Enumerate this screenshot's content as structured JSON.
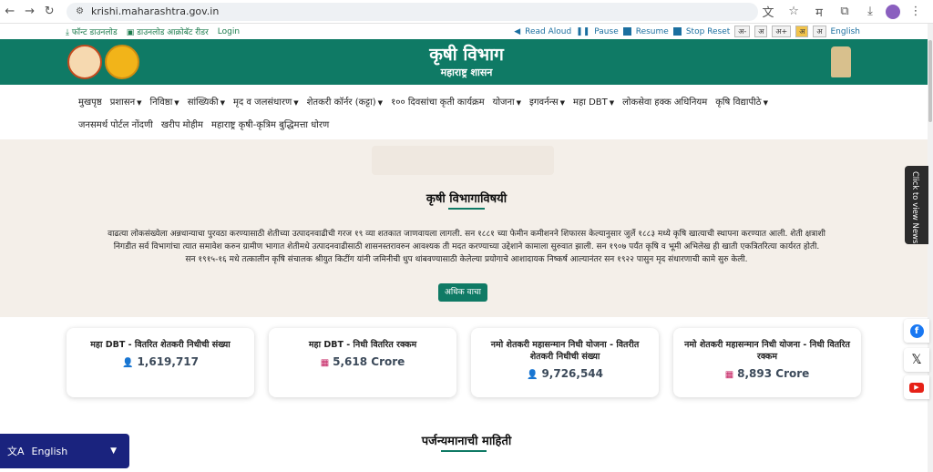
{
  "browser": {
    "url": "krishi.maharashtra.gov.in",
    "profile_initial": "म"
  },
  "toolbar": {
    "font_download": "फॉन्ट डाउनलोड",
    "acrobat_download": "डाउनलोड आक्रोबॅट रीडर",
    "login": "Login",
    "read_aloud": "Read Aloud",
    "pause": "Pause",
    "resume": "Resume",
    "stop_reset": "Stop Reset",
    "font_small": "अ-",
    "font_normal": "अ",
    "font_large": "अ+",
    "contrast1": "अ",
    "contrast2": "अ",
    "english": "English"
  },
  "header": {
    "title": "कृषी विभाग",
    "subtitle": "महाराष्ट्र शासन"
  },
  "nav": {
    "row1": [
      {
        "label": "मुखपृष्ठ",
        "dropdown": false
      },
      {
        "label": "प्रशासन",
        "dropdown": true
      },
      {
        "label": "निविष्ठा",
        "dropdown": true
      },
      {
        "label": "सांख्यिकी",
        "dropdown": true
      },
      {
        "label": "मृद व जलसंधारण",
        "dropdown": true
      },
      {
        "label": "शेतकरी कॉर्नर (कट्टा)",
        "dropdown": true
      },
      {
        "label": "१०० दिवसांचा कृती कार्यक्रम",
        "dropdown": false
      },
      {
        "label": "योजना",
        "dropdown": true
      },
      {
        "label": "इगवर्नन्स",
        "dropdown": true
      },
      {
        "label": "महा DBT",
        "dropdown": true
      },
      {
        "label": "लोकसेवा हक्क अधिनियम",
        "dropdown": false
      },
      {
        "label": "कृषि विद्यापीठे",
        "dropdown": true
      }
    ],
    "row2": [
      {
        "label": "जनसमर्थ पोर्टल नोंदणी"
      },
      {
        "label": "खरीप मोहीम"
      },
      {
        "label": "महाराष्ट्र कृषी-कृत्रिम बुद्धिमत्ता धोरण"
      }
    ]
  },
  "about": {
    "title": "कृषी विभागाविषयी",
    "text": "वाढत्या लोकसंख्येला अन्नधान्याचा पुरवठा करण्यासाठी शेतीच्या उत्पादनवाढीची गरज १९ व्या शतकात जाणवायला लागली. सन १८८१ च्या फेमीन कमीशनने शिफारस केल्यानुसार जुर्ले १८८३ मध्ये कृषि खात्याची स्थापना करण्यात आली. शेती क्षत्राशी निगडीत सर्व विभागांचा त्यात समावेश करुन ग्रामीण भागात शेतीमधे उत्पादनवाढीसाठी शासनस्तरावरुन आवश्यक ती मदत करण्याच्या उद्देशाने कामाला सुरुवात झाली. सन १९०७ पर्यंत कृषि व भूमी अभिलेख ही खाती एकत्रितरित्या कार्यरत होती. सन १९१५-१६ मधे तत्कालीन कृषि संचालक श्रीयुत किटींग यांनी जमिनीची धुप थांबवण्यासाठी केलेल्या प्रयोगाचे आशादायक निष्कर्ष आल्यानंतर सन १९२२ पासुन मृद संधारणाची कामे सुरु केली.",
    "more_button": "अधिक वाचा"
  },
  "stats": [
    {
      "title": "महा DBT - वितरित शेतकरी निधीची संख्या",
      "value": "1,619,717",
      "icon": "user-plus-icon"
    },
    {
      "title": "महा DBT - निधी वितरित रक्कम",
      "value": "5,618 Crore",
      "icon": "grid-icon"
    },
    {
      "title": "नमो शेतकरी महासन्मान निधी योजना - वितरीत शेतकरी निधीची संख्या",
      "value": "9,726,544",
      "icon": "user-plus-icon"
    },
    {
      "title": "नमो शेतकरी महासन्मान निधी योजना - निधी वितरित रक्कम",
      "value": "8,893 Crore",
      "icon": "grid-icon"
    }
  ],
  "rain_section": {
    "title": "पर्जन्यमानाची माहिती"
  },
  "language_widget": {
    "label": "English"
  },
  "news_tab": {
    "label": "Click to view News"
  },
  "colors": {
    "primary": "#0f7a65",
    "accent": "#c2185b",
    "lang_bg": "#1a237e"
  }
}
